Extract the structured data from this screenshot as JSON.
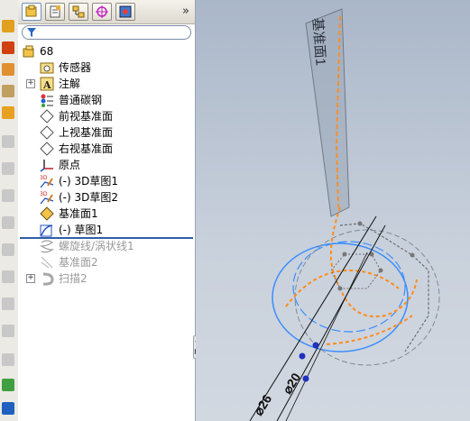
{
  "toolbar": {
    "expand_label": "»",
    "tabs": [
      {
        "name": "feature-manager",
        "icon": "feature-tree-icon"
      },
      {
        "name": "property-manager",
        "icon": "property-icon"
      },
      {
        "name": "configuration-manager",
        "icon": "configuration-icon"
      },
      {
        "name": "dim-xpert",
        "icon": "crosshair-icon"
      },
      {
        "name": "display-manager",
        "icon": "display-icon"
      }
    ]
  },
  "filter": {
    "icon": "filter-icon"
  },
  "tree": {
    "root": "68",
    "items": [
      {
        "label": "传感器",
        "icon": "sensor-icon"
      },
      {
        "label": "注解",
        "icon": "annotation-icon"
      },
      {
        "label": "普通碳钢",
        "icon": "material-icon"
      },
      {
        "label": "前视基准面",
        "icon": "plane-icon"
      },
      {
        "label": "上视基准面",
        "icon": "plane-icon"
      },
      {
        "label": "右视基准面",
        "icon": "plane-icon"
      },
      {
        "label": "原点",
        "icon": "origin-icon"
      },
      {
        "label": "(-) 3D草图1",
        "icon": "sketch-3d-icon"
      },
      {
        "label": "(-) 3D草图2",
        "icon": "sketch-3d-icon"
      },
      {
        "label": "基准面1",
        "icon": "plane-yellow-icon"
      },
      {
        "label": "(-) 草图1",
        "icon": "sketch-icon"
      },
      {
        "label": "螺旋线/涡状线1",
        "icon": "helix-icon"
      },
      {
        "label": "基准面2",
        "icon": "plane-icon"
      },
      {
        "label": "扫描2",
        "icon": "sweep-icon"
      }
    ]
  },
  "viewport": {
    "plane_label": "基准面1",
    "dim_1": "⌀26",
    "dim_2": "⌀20",
    "colors": {
      "sketch": "#ff8c1a",
      "helix": "#3a8dff",
      "edges": "#6e6e6e",
      "background": "#c2cbd8"
    }
  }
}
